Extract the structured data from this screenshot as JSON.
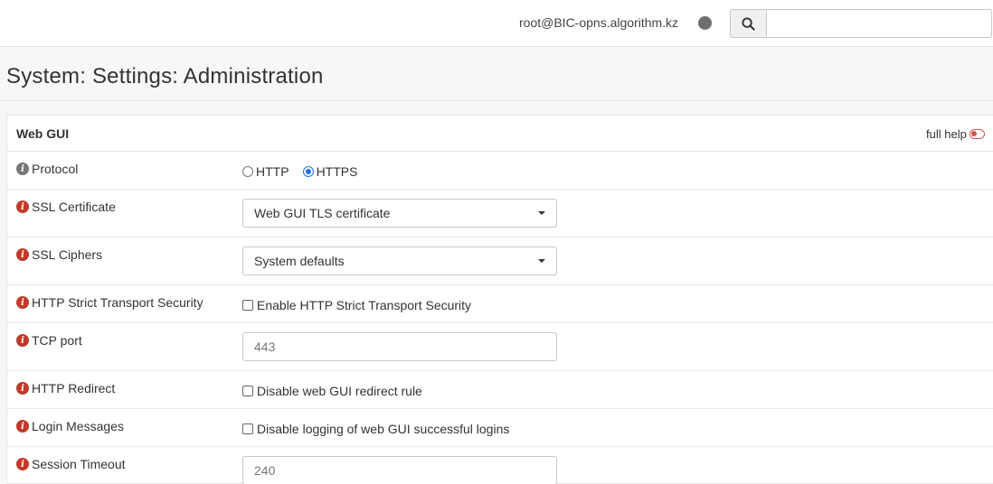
{
  "header": {
    "user": "root@BIC-opns.algorithm.kz",
    "search_value": ""
  },
  "page": {
    "title": "System: Settings: Administration"
  },
  "panel": {
    "title": "Web GUI",
    "full_help_label": "full help"
  },
  "rows": {
    "protocol": {
      "label": "Protocol",
      "options": [
        "HTTP",
        "HTTPS"
      ],
      "selected": "HTTPS"
    },
    "ssl_certificate": {
      "label": "SSL Certificate",
      "value": "Web GUI TLS certificate"
    },
    "ssl_ciphers": {
      "label": "SSL Ciphers",
      "value": "System defaults"
    },
    "hsts": {
      "label": "HTTP Strict Transport Security",
      "checkbox_label": "Enable HTTP Strict Transport Security",
      "checked": false
    },
    "tcp_port": {
      "label": "TCP port",
      "placeholder": "443"
    },
    "http_redirect": {
      "label": "HTTP Redirect",
      "checkbox_label": "Disable web GUI redirect rule",
      "checked": false
    },
    "login_messages": {
      "label": "Login Messages",
      "checkbox_label": "Disable logging of web GUI successful logins",
      "checked": false
    },
    "session_timeout": {
      "label": "Session Timeout",
      "placeholder": "240"
    }
  },
  "colors": {
    "info_default": "#777777",
    "info_changed": "#c0392b",
    "accent_blue": "#1a73e8",
    "toggle_red": "#d9534f"
  }
}
